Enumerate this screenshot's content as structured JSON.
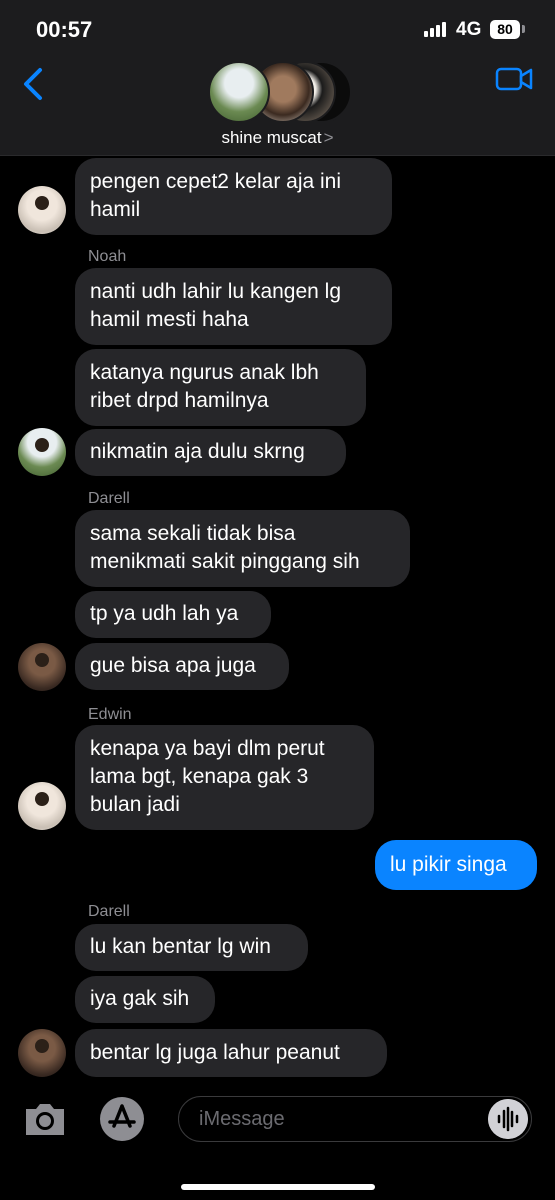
{
  "status_bar": {
    "time": "00:57",
    "network": "4G",
    "battery": "80"
  },
  "header": {
    "group_name": "shine muscat",
    "chevron": ">"
  },
  "messages": [
    {
      "sender": "",
      "text": "pengen cepet2 kelar aja ini\nhamil",
      "from_me": false
    },
    {
      "sender": "Noah",
      "text": "nanti udh lahir lu kangen lg\nhamil mesti haha",
      "from_me": false
    },
    {
      "sender": "",
      "text": "katanya ngurus anak lbh\nribet drpd hamilnya",
      "from_me": false
    },
    {
      "sender": "",
      "text": "nikmatin aja dulu skrng",
      "from_me": false
    },
    {
      "sender": "Darell",
      "text": "sama sekali tidak bisa\nmenikmati sakit pinggang sih",
      "from_me": false
    },
    {
      "sender": "",
      "text": "tp ya udh lah ya",
      "from_me": false
    },
    {
      "sender": "",
      "text": "gue bisa apa juga",
      "from_me": false
    },
    {
      "sender": "Edwin",
      "text": "kenapa ya bayi dlm perut\nlama bgt, kenapa gak 3\nbulan jadi",
      "from_me": false
    },
    {
      "sender": "",
      "text": "lu pikir singa",
      "from_me": true
    },
    {
      "sender": "Darell",
      "text": "lu kan bentar lg win",
      "from_me": false
    },
    {
      "sender": "",
      "text": "iya gak sih",
      "from_me": false
    },
    {
      "sender": "",
      "text": "bentar lg juga lahur peanut",
      "from_me": false
    }
  ],
  "compose": {
    "placeholder": "iMessage"
  },
  "colors": {
    "accent": "#0a84ff",
    "bubble_received": "#262629",
    "background": "#000000"
  }
}
